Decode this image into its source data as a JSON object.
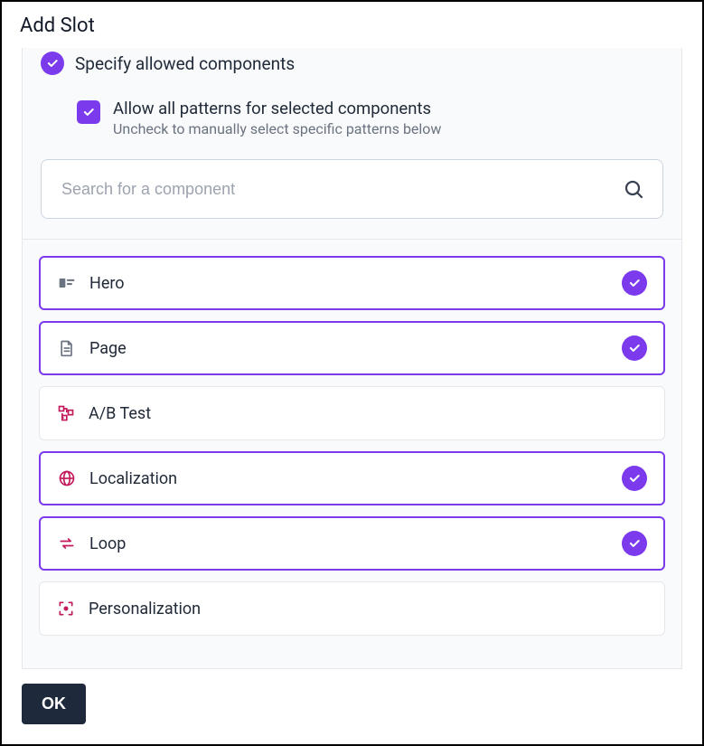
{
  "dialog": {
    "title": "Add Slot",
    "step_label": "Specify allowed components",
    "allow_all_label": "Allow all patterns for selected components",
    "allow_all_hint": "Uncheck to manually select specific patterns below",
    "allow_all_checked": true,
    "search_placeholder": "Search for a component",
    "ok_label": "OK"
  },
  "colors": {
    "accent": "#7c3aed",
    "magenta": "#c2185b",
    "gray_icon": "#6b7280"
  },
  "components": [
    {
      "id": "hero",
      "label": "Hero",
      "selected": true,
      "icon": "hero",
      "icon_color": "gray_icon"
    },
    {
      "id": "page",
      "label": "Page",
      "selected": true,
      "icon": "page",
      "icon_color": "gray_icon"
    },
    {
      "id": "ab-test",
      "label": "A/B Test",
      "selected": false,
      "icon": "branch",
      "icon_color": "magenta"
    },
    {
      "id": "localization",
      "label": "Localization",
      "selected": true,
      "icon": "globe",
      "icon_color": "magenta"
    },
    {
      "id": "loop",
      "label": "Loop",
      "selected": true,
      "icon": "loop",
      "icon_color": "magenta"
    },
    {
      "id": "personalization",
      "label": "Personalization",
      "selected": false,
      "icon": "target",
      "icon_color": "magenta"
    }
  ]
}
